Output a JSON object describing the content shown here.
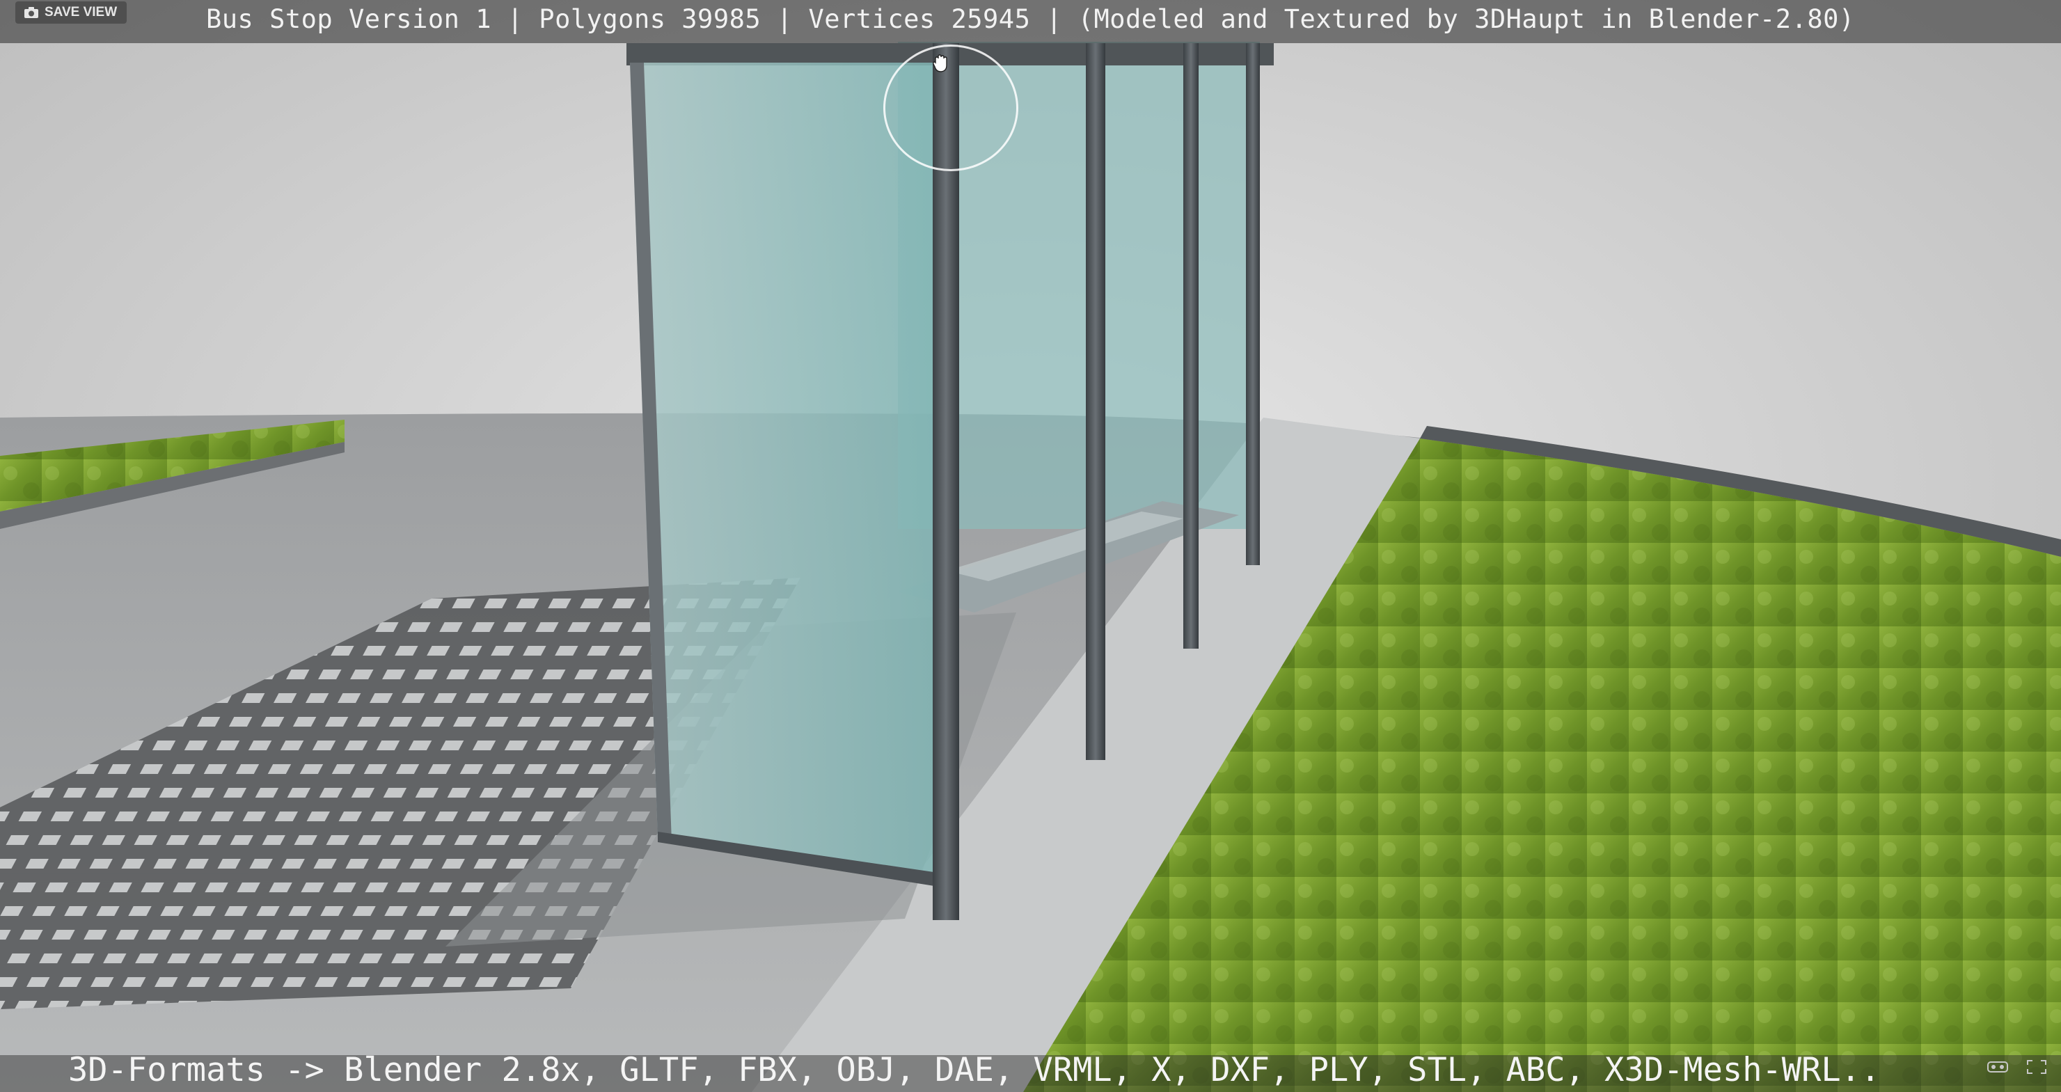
{
  "header": {
    "title": "Bus Stop Version 1 | Polygons 39985 | Vertices 25945 | (Modeled and Textured by 3DHaupt in Blender-2.80)",
    "save_view_label": "SAVE VIEW",
    "save_view_icon": "camera-icon"
  },
  "footer": {
    "formats": "3D-Formats -> Blender 2.8x, GLTF, FBX, OBJ, DAE, VRML, X, DXF, PLY, STL, ABC, X3D-Mesh-WRL..",
    "icons": [
      "vr-icon",
      "fullscreen-icon"
    ]
  },
  "cursor": {
    "icon": "hand-grab-icon"
  },
  "colors": {
    "grass": "#7fa132",
    "pavement": "#b9bbbc",
    "glass": "#8fc3c2",
    "post": "#4a4f53",
    "background": "#dcdcdc"
  }
}
